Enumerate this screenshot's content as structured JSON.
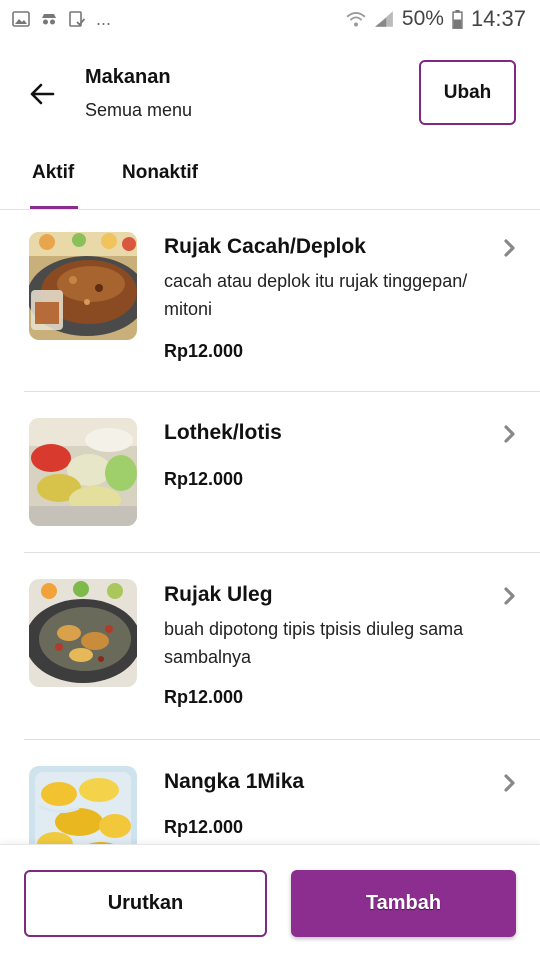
{
  "status_bar": {
    "icons_left": [
      "image-icon",
      "incognito-icon",
      "clipboard-check-icon"
    ],
    "more": "...",
    "battery_percent": "50%",
    "time": "14:37"
  },
  "header": {
    "title": "Makanan",
    "subtitle": "Semua menu",
    "edit_label": "Ubah"
  },
  "tabs": [
    {
      "label": "Aktif",
      "active": true
    },
    {
      "label": "Nonaktif",
      "active": false
    }
  ],
  "items": [
    {
      "name": "Rujak Cacah/Deplok",
      "description": "cacah atau deplok itu rujak tinggepan/ mitoni",
      "price": "Rp12.000"
    },
    {
      "name": "Lothek/lotis",
      "description": "",
      "price": "Rp12.000"
    },
    {
      "name": "Rujak Uleg",
      "description": "buah dipotong tipis tpisis diuleg sama sambalnya",
      "price": "Rp12.000"
    },
    {
      "name": "Nangka 1Mika",
      "description": "",
      "price": "Rp12.000"
    }
  ],
  "actions": {
    "sort_label": "Urutkan",
    "add_label": "Tambah"
  },
  "colors": {
    "accent": "#8b2e8f",
    "border_accent": "#7e2a82"
  }
}
